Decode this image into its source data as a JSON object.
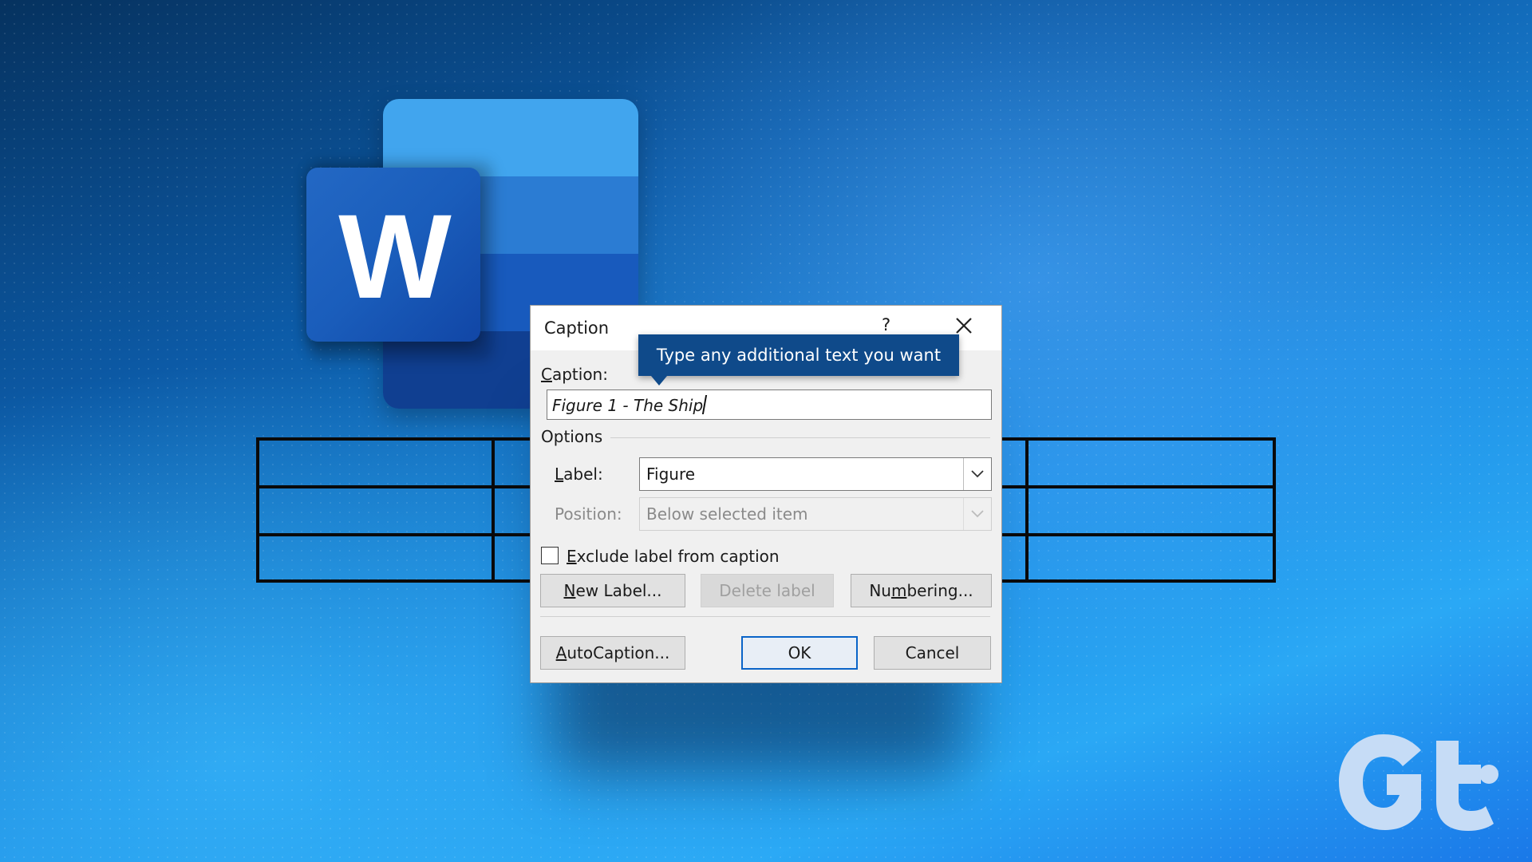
{
  "app": {
    "icon_letter": "W"
  },
  "dialog": {
    "title": "Caption",
    "help_label": "?",
    "caption_label_pre": "C",
    "caption_label_post": "aption:",
    "caption_value": "Figure 1 - The Ship",
    "options_label": "Options",
    "label_field_pre": "L",
    "label_field_post": "abel:",
    "label_value": "Figure",
    "position_label": "Position:",
    "position_value": "Below selected item",
    "exclude_pre": "E",
    "exclude_post": "xclude label from caption",
    "exclude_checked": false,
    "new_label_pre": "N",
    "new_label_post": "ew Label...",
    "delete_label": "Delete label",
    "numbering_pre": "Nu",
    "numbering_u": "m",
    "numbering_post": "bering...",
    "autocaption_pre": "A",
    "autocaption_post": "utoCaption...",
    "ok": "OK",
    "cancel": "Cancel"
  },
  "tooltip": {
    "text": "Type any additional text you want"
  },
  "colors": {
    "word_blue": "#185abd",
    "tooltip_bg": "#0f4a8a",
    "dialog_bg": "#f0f0f0",
    "gt_logo": "#c6dcf6"
  },
  "icons": {
    "close": "close-icon",
    "dropdown": "chevron-down-icon",
    "brand": "gt-logo"
  }
}
